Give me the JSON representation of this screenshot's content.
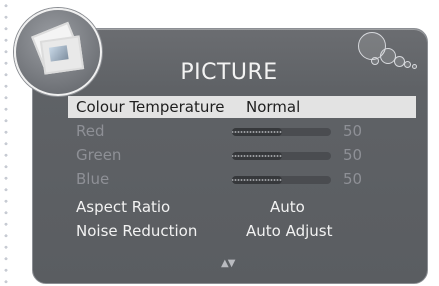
{
  "menu": {
    "title": "PICTURE",
    "rows": [
      {
        "label": "Colour Temperature",
        "value": "Normal"
      },
      {
        "label": "Red",
        "value": "50",
        "level": 0.5
      },
      {
        "label": "Green",
        "value": "50",
        "level": 0.5
      },
      {
        "label": "Blue",
        "value": "50",
        "level": 0.5
      },
      {
        "label": "Aspect Ratio",
        "value": "Auto"
      },
      {
        "label": "Noise Reduction",
        "value": "Auto Adjust"
      }
    ],
    "nav_hint": "▲▼"
  },
  "icons": {
    "picture_menu": "photo-icon",
    "decoration": "bubbles-icon"
  },
  "colors": {
    "panel": "#5f6266",
    "selected_row": "#e3e3e3",
    "dim_text": "#8e9096"
  }
}
